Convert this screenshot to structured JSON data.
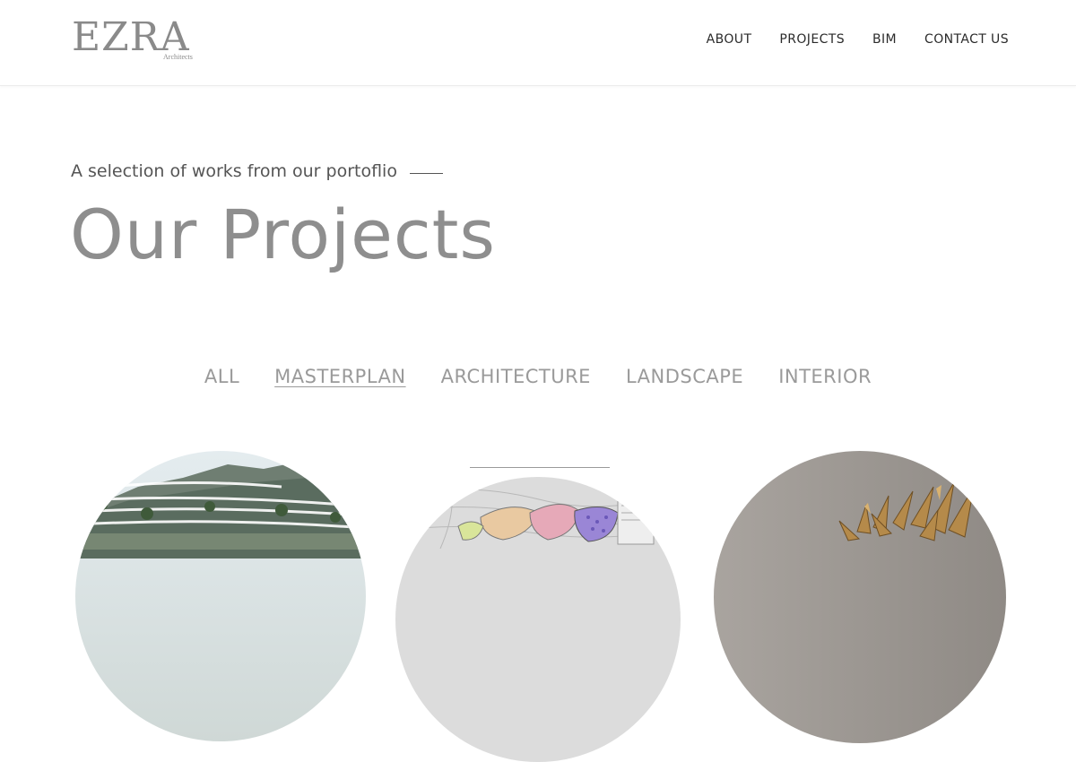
{
  "header": {
    "logo": {
      "name": "EZRA",
      "tagline": "Architects"
    },
    "nav": [
      {
        "label": "ABOUT"
      },
      {
        "label": "PROJECTS"
      },
      {
        "label": "BIM"
      },
      {
        "label": "CONTACT US"
      }
    ]
  },
  "hero": {
    "subtitle": "A selection of works from our portoflio",
    "title": "Our Projects"
  },
  "filters": {
    "items": [
      {
        "label": "ALL"
      },
      {
        "label": "MASTERPLAN"
      },
      {
        "label": "ARCHITECTURE"
      },
      {
        "label": "LANDSCAPE"
      },
      {
        "label": "INTERIOR"
      }
    ],
    "active": "MASTERPLAN"
  },
  "projects": [
    {
      "image": "terraced-buildings-rendering"
    },
    {
      "image": "masterplan-site-map"
    },
    {
      "image": "interior-sculpture-photo"
    }
  ],
  "colors": {
    "text_dark": "#2b2b2b",
    "text_grey": "#8e8e8e",
    "filter_grey": "#9a9a9a",
    "background": "#ffffff"
  }
}
